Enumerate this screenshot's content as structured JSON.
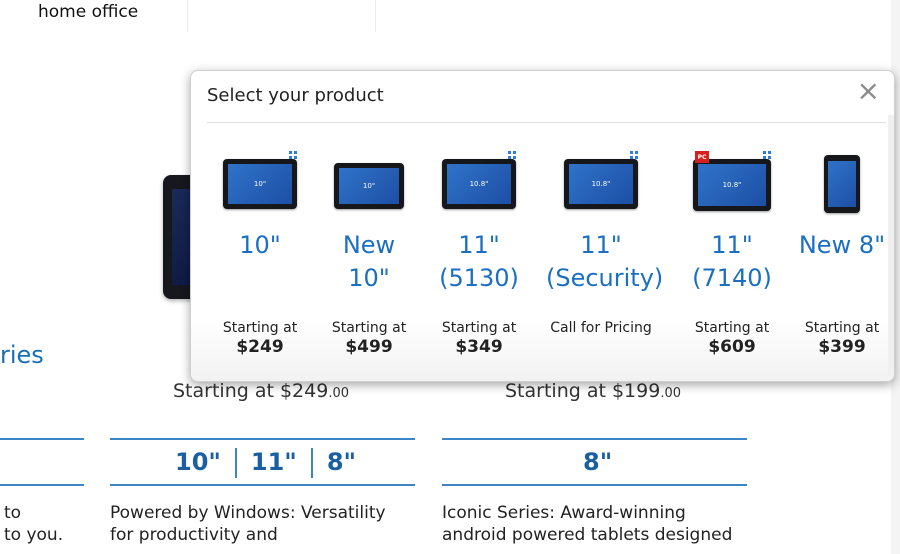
{
  "nav": {
    "home_office": "home office"
  },
  "background": {
    "series_partial": "ries",
    "price_a": {
      "prefix": "Starting at ",
      "amount": "$249",
      "cents": ".00"
    },
    "price_b": {
      "prefix": "Starting at ",
      "amount": "$199",
      "cents": ".00"
    },
    "sizes_a": [
      "10\"",
      "11\"",
      "8\""
    ],
    "sizes_b": [
      "8\""
    ],
    "desc_left": [
      "to",
      "to you."
    ],
    "desc_a": [
      "Powered by Windows: Versatility",
      "for productivity and"
    ],
    "desc_b": [
      "Iconic Series: Award-winning",
      "android powered tablets designed"
    ]
  },
  "modal": {
    "title": "Select your product",
    "close_label": "×",
    "products": [
      {
        "name_line1": "10\"",
        "name_line2": "",
        "screen_label": "10\"",
        "start": "Starting at",
        "price": "$249",
        "badges": [
          "windows"
        ]
      },
      {
        "name_line1": "New",
        "name_line2": "10\"",
        "screen_label": "10\"",
        "start": "Starting at",
        "price": "$499",
        "badges": []
      },
      {
        "name_line1": "11\"",
        "name_line2": "(5130)",
        "screen_label": "10.8\"",
        "start": "Starting at",
        "price": "$349",
        "badges": [
          "windows"
        ]
      },
      {
        "name_line1": "11\"",
        "name_line2": "(Security)",
        "screen_label": "10.8\"",
        "start": "Call for Pricing",
        "price": "",
        "badges": [
          "windows"
        ]
      },
      {
        "name_line1": "11\"",
        "name_line2": "(7140)",
        "screen_label": "10.8\"",
        "start": "Starting at",
        "price": "$609",
        "badges": [
          "pc",
          "windows"
        ]
      },
      {
        "name_line1": "New 8\"",
        "name_line2": "",
        "screen_label": "",
        "start": "Starting at",
        "price": "$399",
        "badges": []
      }
    ]
  }
}
